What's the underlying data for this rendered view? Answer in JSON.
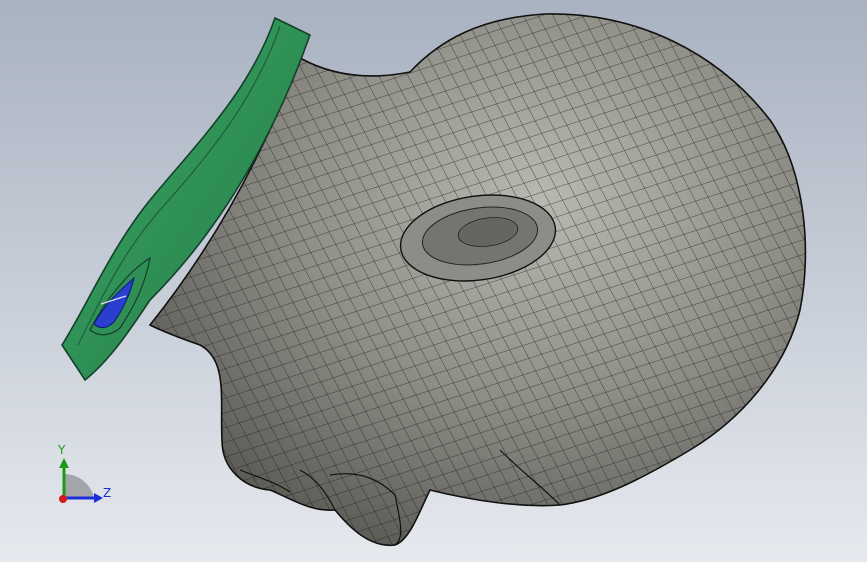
{
  "scene": {
    "model_color": "#8c8b85",
    "mesh_line_color": "#1d1d1d",
    "part_color": "#2f8f57",
    "part_dark_color": "#1f5e3a",
    "part_accent_color": "#2a3fd0"
  },
  "triad": {
    "y_label": "Y",
    "z_label": "Z",
    "y_color": "#1a9a1a",
    "z_color": "#1c2fd8",
    "x_color": "#d01a1a",
    "plane_color": "#9a9aa0"
  }
}
